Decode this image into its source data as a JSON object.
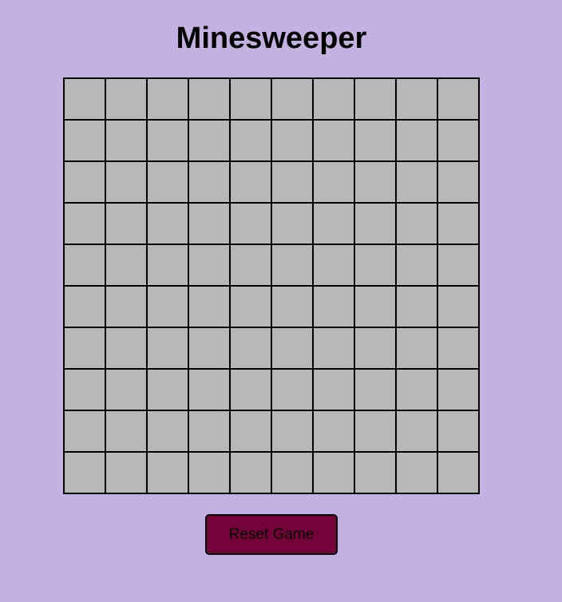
{
  "page": {
    "title": "Minesweeper",
    "background_color": "#c3b1e1"
  },
  "board": {
    "rows": 10,
    "columns": 10,
    "cell_state": "unrevealed",
    "cell_color": "#b8b8b8",
    "border_color": "#000000"
  },
  "controls": {
    "reset_label": "Reset Game",
    "reset_color": "#720238"
  }
}
